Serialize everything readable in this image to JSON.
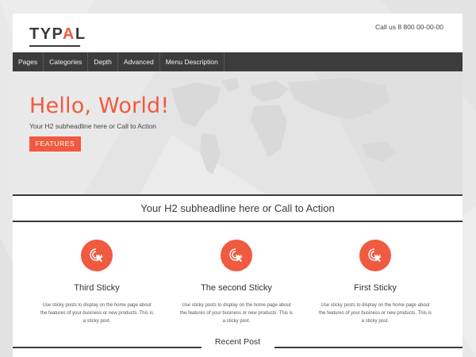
{
  "brand": {
    "logo_prefix": "TYP",
    "logo_accent": "A",
    "logo_suffix": "L",
    "accent_color": "#ef5a40",
    "dark_color": "#3c3c3c"
  },
  "header": {
    "phone": "Call us 8 800 00-00-00"
  },
  "nav": {
    "items": [
      {
        "label": "Pages"
      },
      {
        "label": "Categories"
      },
      {
        "label": "Depth"
      },
      {
        "label": "Advanced"
      },
      {
        "label": "Menu Description"
      }
    ]
  },
  "hero": {
    "title": "Hello, World!",
    "subtitle": "Your H2 subheadline here or Call to Action",
    "button_label": "FEATURES"
  },
  "band": {
    "text": "Your H2 subheadline here or Call to Action"
  },
  "features": [
    {
      "icon": "cursor-click-icon",
      "title": "Third Sticky",
      "text": "Use sticky posts to display on the home page about the features of your business or new products. This is a sticky post."
    },
    {
      "icon": "cursor-click-icon",
      "title": "The second Sticky",
      "text": "Use sticky posts to display on the home page about the features of your business or new products. This is a sticky post."
    },
    {
      "icon": "cursor-click-icon",
      "title": "First Sticky",
      "text": "Use sticky posts to display on the home page about the features of your business or new products. This is a sticky post."
    }
  ],
  "recent": {
    "title": "Recent Post"
  }
}
